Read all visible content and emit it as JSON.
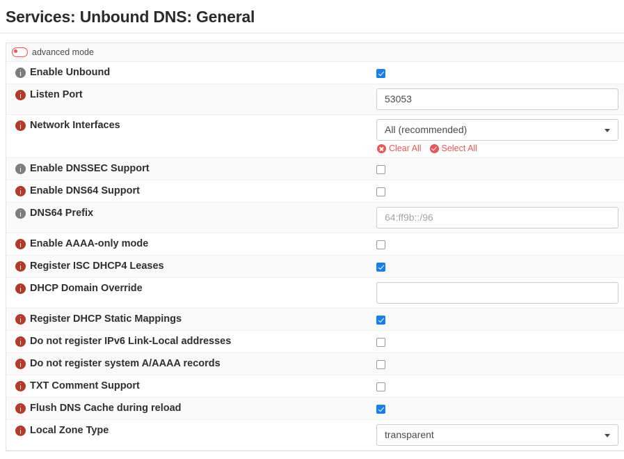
{
  "page": {
    "title": "Services: Unbound DNS: General"
  },
  "advanced": {
    "label": "advanced mode",
    "state": "off",
    "toggle_color": "#ef5350"
  },
  "colors": {
    "info_red": "#b23b28",
    "info_gray": "#7c7c7c",
    "checkbox_checked": "#1a7fe8",
    "link_red": "#e8575a"
  },
  "interface_actions": {
    "clear_all": "Clear All",
    "select_all": "Select All"
  },
  "rows": [
    {
      "label": "Enable Unbound",
      "icon": "info-icon-gray",
      "control": "checkbox",
      "checked": true,
      "stripe": "plain"
    },
    {
      "label": "Listen Port",
      "icon": "info-icon-red",
      "control": "text",
      "value": "53053",
      "placeholder": "",
      "stripe": "alt"
    },
    {
      "label": "Network Interfaces",
      "icon": "info-icon-red",
      "control": "select-multi",
      "value": "All (recommended)",
      "stripe": "plain"
    },
    {
      "label": "Enable DNSSEC Support",
      "icon": "info-icon-gray",
      "control": "checkbox",
      "checked": false,
      "stripe": "alt"
    },
    {
      "label": "Enable DNS64 Support",
      "icon": "info-icon-red",
      "control": "checkbox",
      "checked": false,
      "stripe": "plain"
    },
    {
      "label": "DNS64 Prefix",
      "icon": "info-icon-gray",
      "control": "text",
      "value": "",
      "placeholder": "64:ff9b::/96",
      "stripe": "alt"
    },
    {
      "label": "Enable AAAA-only mode",
      "icon": "info-icon-red",
      "control": "checkbox",
      "checked": false,
      "stripe": "plain"
    },
    {
      "label": "Register ISC DHCP4 Leases",
      "icon": "info-icon-red",
      "control": "checkbox",
      "checked": true,
      "stripe": "alt"
    },
    {
      "label": "DHCP Domain Override",
      "icon": "info-icon-red",
      "control": "text",
      "value": "",
      "placeholder": "",
      "stripe": "plain"
    },
    {
      "label": "Register DHCP Static Mappings",
      "icon": "info-icon-red",
      "control": "checkbox",
      "checked": true,
      "stripe": "alt"
    },
    {
      "label": "Do not register IPv6 Link-Local addresses",
      "icon": "info-icon-red",
      "control": "checkbox",
      "checked": false,
      "stripe": "plain"
    },
    {
      "label": "Do not register system A/AAAA records",
      "icon": "info-icon-red",
      "control": "checkbox",
      "checked": false,
      "stripe": "alt"
    },
    {
      "label": "TXT Comment Support",
      "icon": "info-icon-red",
      "control": "checkbox",
      "checked": false,
      "stripe": "plain"
    },
    {
      "label": "Flush DNS Cache during reload",
      "icon": "info-icon-red",
      "control": "checkbox",
      "checked": true,
      "stripe": "alt"
    },
    {
      "label": "Local Zone Type",
      "icon": "info-icon-red",
      "control": "select",
      "value": "transparent",
      "stripe": "plain"
    }
  ]
}
